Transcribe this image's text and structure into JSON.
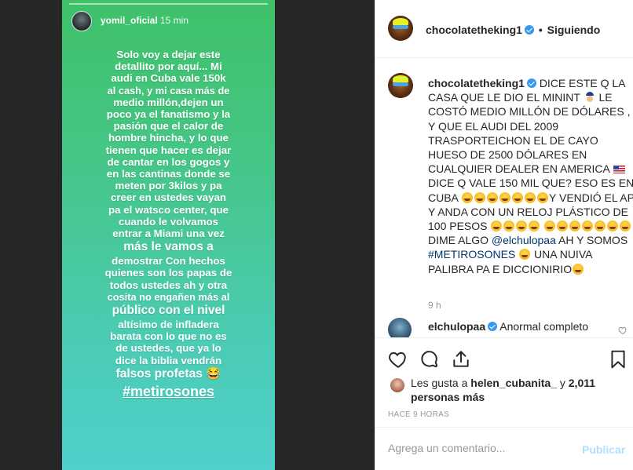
{
  "story": {
    "username": "yomil_oficial",
    "time": "15 min",
    "lines": [
      {
        "text": "Solo voy a dejar este",
        "style": "normal"
      },
      {
        "text": "detallito por aquí... Mi",
        "style": "normal"
      },
      {
        "text": "audi en Cuba vale 150k",
        "style": "normal"
      },
      {
        "text": "al cash, y mi casa más de",
        "style": "small"
      },
      {
        "text": "medio millón,dejen un",
        "style": "normal"
      },
      {
        "text": "poco ya el fanatismo y la",
        "style": "normal"
      },
      {
        "text": "pasión que el calor de",
        "style": "normal"
      },
      {
        "text": "hombre hincha, y lo que",
        "style": "normal"
      },
      {
        "text": "tienen que hacer es dejar",
        "style": "normal"
      },
      {
        "text": "de cantar en los gogos y",
        "style": "normal"
      },
      {
        "text": "en las cantinas donde se",
        "style": "normal"
      },
      {
        "text": "meten por 3kilos y pa",
        "style": "normal"
      },
      {
        "text": "creer en ustedes vayan",
        "style": "normal"
      },
      {
        "text": "pa el watsco center, que",
        "style": "normal"
      },
      {
        "text": "cuando le volvamos",
        "style": "normal"
      },
      {
        "text": "entrar a Miami una vez",
        "style": "normal"
      },
      {
        "text": "más le vamos a",
        "style": "big"
      },
      {
        "text": "demostrar Con hechos",
        "style": "normal"
      },
      {
        "text": "quienes son los papas de",
        "style": "normal"
      },
      {
        "text": "todos ustedes ah y otra",
        "style": "normal"
      },
      {
        "text": "cosita no engañen más al",
        "style": "small"
      },
      {
        "text": "público con el nivel",
        "style": "big"
      },
      {
        "text": "altísimo  de infladera",
        "style": "normal"
      },
      {
        "text": "barata con lo que no es",
        "style": "normal"
      },
      {
        "text": "de ustedes, que ya lo",
        "style": "normal"
      },
      {
        "text": "dice la biblia vendrán",
        "style": "normal"
      },
      {
        "text": "falsos profetas 😂",
        "style": "big"
      }
    ],
    "hashtag": "#metirosones"
  },
  "post": {
    "header": {
      "username": "chocolatetheking1",
      "separator": "•",
      "follow_state": "Siguiendo"
    },
    "caption": {
      "username": "chocolatetheking1",
      "part1": "DICE ESTE Q LA CASA QUE LE DIO EL MININT",
      "part2": "LE COSTÓ MEDIO MILLÓN DE DÓLARES , Y QUE EL AUDI DEL 2009 TRASPORTEICHON EL DE CAYO HUESO DE 2500 DÓLARES EN CUALQUIER DEALER EN AMERICA",
      "part3": "DICE Q VALE 150 MIL QUE? ESO ES EN CUBA",
      "part4": "Y VENDIÓ EL AP Y ANDA CON UN RELOJ PLÁSTICO DE 100 PESOS",
      "part5": "DIME ALGO",
      "mention": "@elchulopaa",
      "part6": "AH Y SOMOS",
      "hashtag": "#METIROSONES",
      "part7": "UNA NUIVA PALIBRA PA E DICCIONIRIO",
      "time": "9 h"
    },
    "reply": {
      "username": "elchulopaa",
      "text": "Anormal completo"
    },
    "likes": {
      "prefix": "Les gusta a",
      "user": "helen_cubanita_",
      "connector": "y",
      "count": "2,011 personas más"
    },
    "date": "HACE 9 HORAS",
    "comment_box": {
      "placeholder": "Agrega un comentario...",
      "publish_label": "Publicar"
    }
  },
  "colors": {
    "verified": "#3897f0",
    "mention": "#003569",
    "publish_disabled": "#b2dffc",
    "muted": "#999999"
  },
  "icons": [
    "heart-icon",
    "comment-icon",
    "share-icon",
    "bookmark-icon",
    "verified-badge-icon"
  ]
}
